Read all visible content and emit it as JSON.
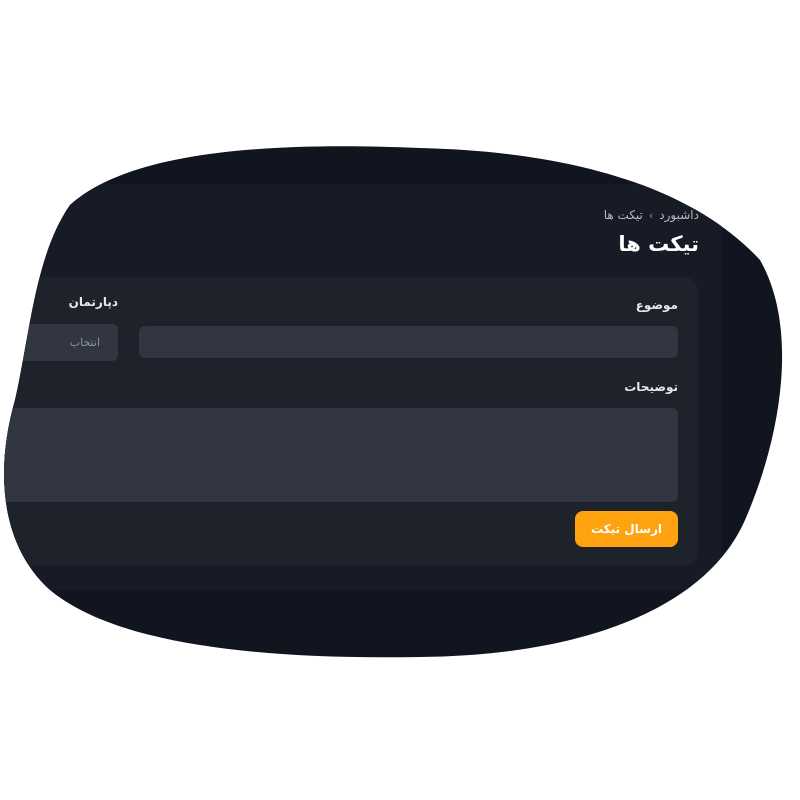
{
  "breadcrumb": {
    "root": "داشبورد",
    "separator": "›",
    "current": "تیکت ها"
  },
  "page": {
    "title": "تیکت ها"
  },
  "form": {
    "subject_label": "موضوع",
    "subject_value": "",
    "department_label": "دپارتمان",
    "department_placeholder": "انتخاب",
    "description_label": "توضیحات",
    "description_value": "",
    "submit_label": "ارسال تیکت"
  },
  "colors": {
    "background": "#111520",
    "panel": "#161b25",
    "card": "#1e222b",
    "input": "#323640",
    "accent": "#ffa20f"
  }
}
